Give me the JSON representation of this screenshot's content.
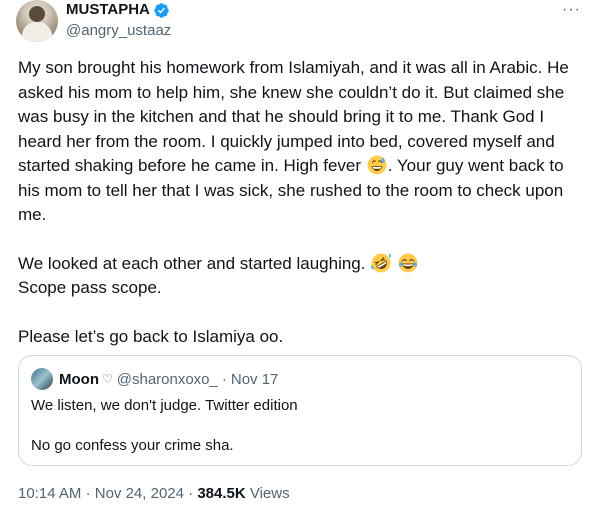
{
  "author": {
    "display_name": "MUSTAPHA",
    "handle": "@angry_ustaaz",
    "verified_icon": "verified-badge-icon",
    "more_label": "···"
  },
  "tweet": {
    "lines": {
      "p1": "My son brought his homework from Islamiyah, and it was all in Arabic. He asked his mom to help him, she knew she couldn’t do it. But claimed she was busy in the kitchen and that he should bring it to me. Thank God I heard her from the room. I quickly jumped into bed, covered myself and started shaking before he came in. High fever",
      "p1_after": ". Your guy went back to his mom to tell her that I was sick, she rushed to the room to check upon me.",
      "p2": "We looked at each other and started laughing.",
      "p3": "Scope pass scope.",
      "p4": "Please let’s go back to Islamiya oo."
    },
    "emojis": [
      "grinning-sweat-emoji",
      "rolling-laughing-emoji",
      "tears-of-joy-emoji"
    ]
  },
  "quote": {
    "display_name": "Moon",
    "heart": "♡",
    "handle": "@sharonxoxo_",
    "dot": "·",
    "date": "Nov 17",
    "line1": "We listen, we don't judge. Twitter edition",
    "line2": "No go confess your crime sha."
  },
  "meta": {
    "time": "10:14 AM",
    "dot1": "·",
    "date": "Nov 24, 2024",
    "dot2": "·",
    "views_count": "384.5K",
    "views_label": "Views"
  },
  "colors": {
    "text": "#0f1419",
    "secondary": "#536471",
    "verified": "#1d9bf0",
    "border": "#cfd9de"
  }
}
